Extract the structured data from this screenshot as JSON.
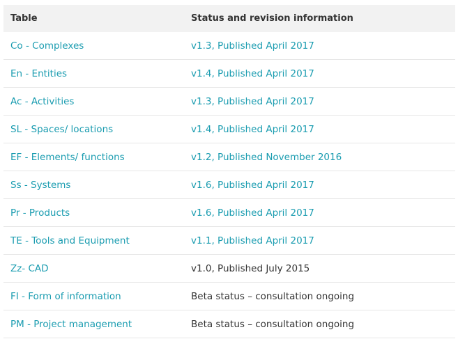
{
  "table": {
    "header": {
      "col1": "Table",
      "col2": "Status and revision information"
    },
    "rows": [
      {
        "name": "Co - Complexes",
        "status": "v1.3, Published April 2017",
        "status_link": true
      },
      {
        "name": "En - Entities",
        "status": "v1.4, Published April 2017",
        "status_link": true
      },
      {
        "name": "Ac - Activities",
        "status": "v1.3, Published April 2017",
        "status_link": true
      },
      {
        "name": "SL - Spaces/ locations",
        "status": "v1.4, Published April 2017",
        "status_link": true
      },
      {
        "name": "EF - Elements/ functions",
        "status": "v1.2, Published November 2016",
        "status_link": true
      },
      {
        "name": "Ss - Systems",
        "status": "v1.6, Published April 2017",
        "status_link": true
      },
      {
        "name": "Pr - Products",
        "status": "v1.6, Published April 2017",
        "status_link": true
      },
      {
        "name": "TE - Tools and Equipment",
        "status": "v1.1, Published April 2017",
        "status_link": true
      },
      {
        "name": "Zz- CAD",
        "status": "v1.0, Published July 2015",
        "status_link": false
      },
      {
        "name": "FI - Form of information",
        "status": "Beta status – consultation ongoing",
        "status_link": false
      },
      {
        "name": "PM - Project management",
        "status": "Beta status – consultation ongoing",
        "status_link": false
      }
    ]
  },
  "colors": {
    "link": "#1a9cb0",
    "text": "#333333",
    "header_bg": "#f2f2f2"
  }
}
